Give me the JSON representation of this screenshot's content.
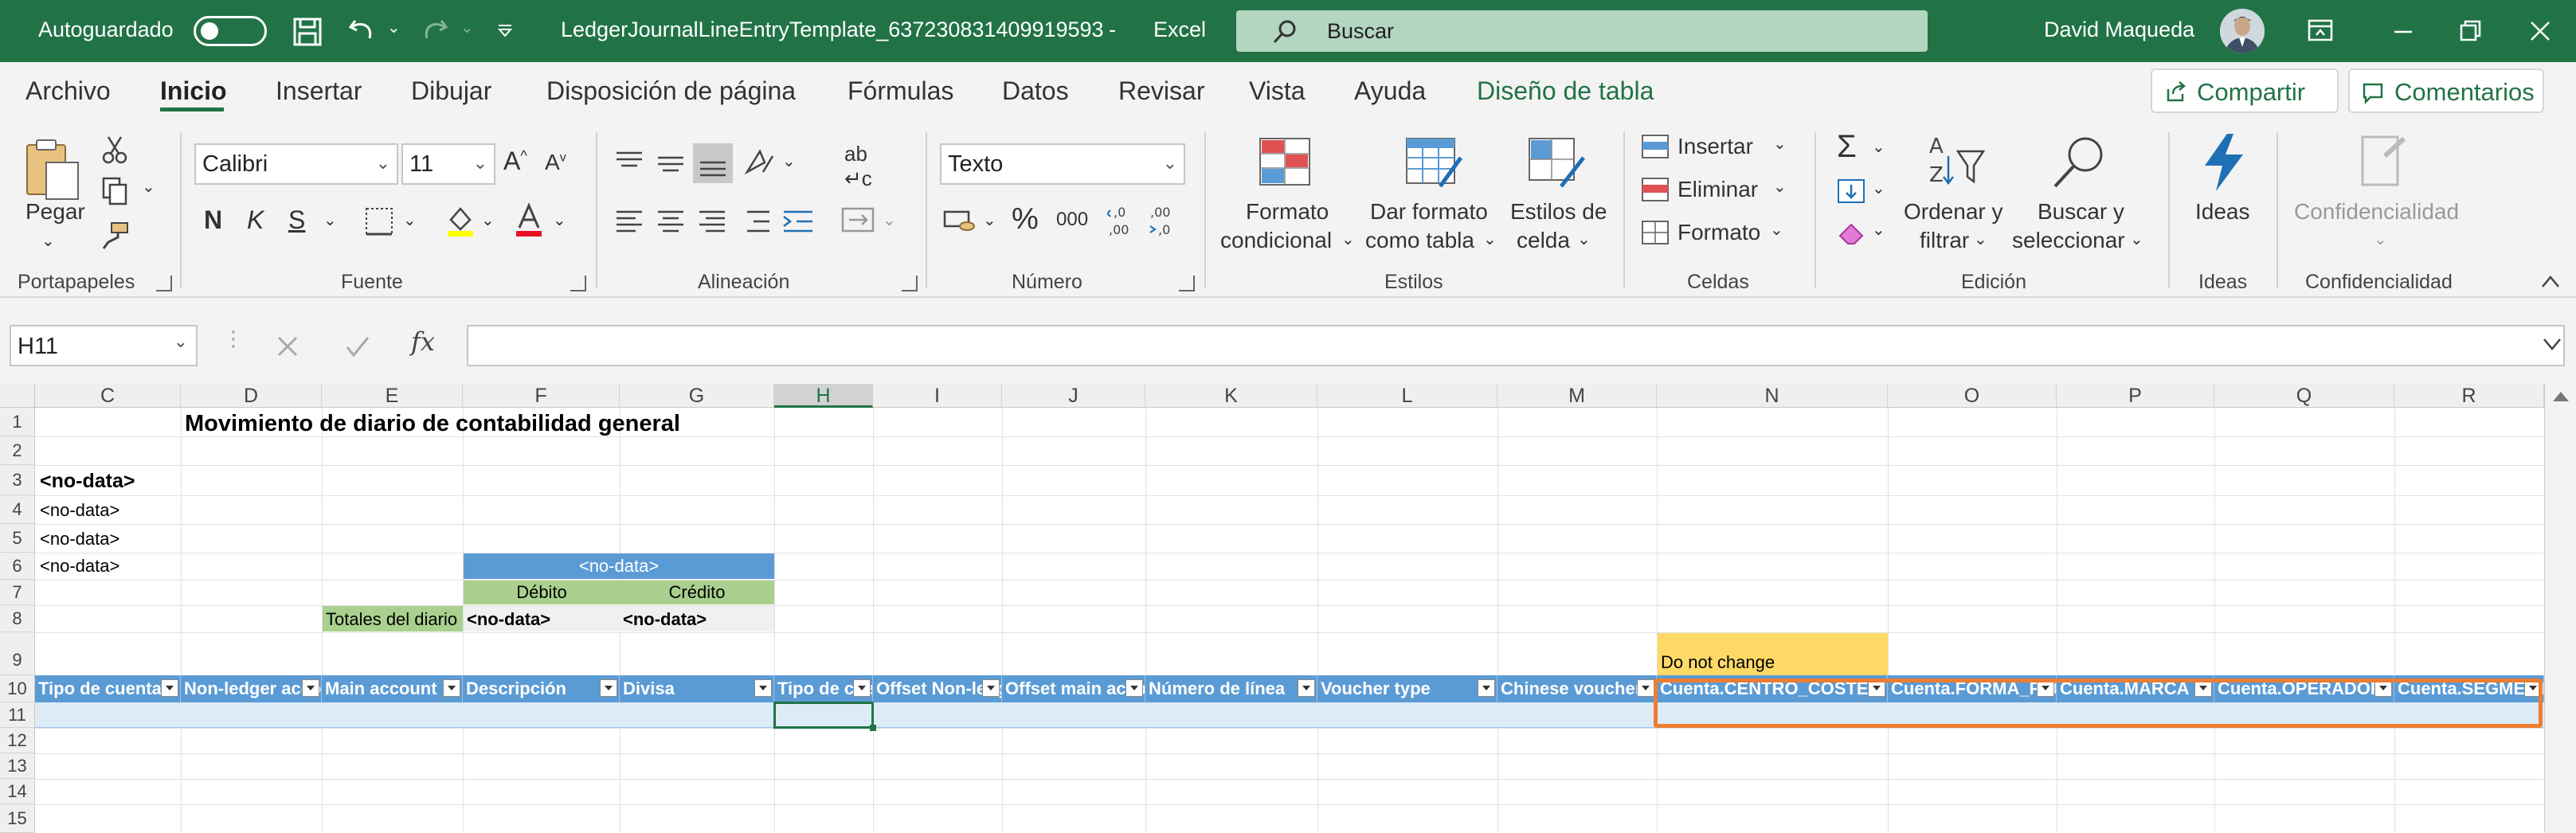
{
  "titlebar": {
    "autosave_label": "Autoguardado",
    "filename": "LedgerJournalLineEntryTemplate_637230831409919593",
    "separator": "-",
    "app": "Excel",
    "search_placeholder": "Buscar",
    "user": "David Maqueda"
  },
  "tabs": [
    {
      "label": "Archivo"
    },
    {
      "label": "Inicio"
    },
    {
      "label": "Insertar"
    },
    {
      "label": "Dibujar"
    },
    {
      "label": "Disposición de página"
    },
    {
      "label": "Fórmulas"
    },
    {
      "label": "Datos"
    },
    {
      "label": "Revisar"
    },
    {
      "label": "Vista"
    },
    {
      "label": "Ayuda"
    },
    {
      "label": "Diseño de tabla"
    }
  ],
  "actions": {
    "share": "Compartir",
    "comments": "Comentarios"
  },
  "ribbon": {
    "clipboard": {
      "paste": "Pegar",
      "label": "Portapapeles"
    },
    "font": {
      "name": "Calibri",
      "size": "11",
      "bold": "N",
      "italic": "K",
      "underline": "S",
      "label": "Fuente"
    },
    "alignment": {
      "label": "Alineación"
    },
    "number": {
      "format": "Texto",
      "percent": "%",
      "thousands": "000",
      "label": "Número"
    },
    "styles": {
      "conditional_1": "Formato",
      "conditional_2": "condicional",
      "table_1": "Dar formato",
      "table_2": "como tabla",
      "cell_1": "Estilos de",
      "cell_2": "celda",
      "label": "Estilos"
    },
    "cells": {
      "insert": "Insertar",
      "delete": "Eliminar",
      "format": "Formato",
      "label": "Celdas"
    },
    "editing": {
      "sort_1": "Ordenar y",
      "sort_2": "filtrar",
      "find_1": "Buscar y",
      "find_2": "seleccionar",
      "label": "Edición"
    },
    "ideas": {
      "button": "Ideas",
      "label": "Ideas"
    },
    "sensitivity": {
      "button": "Confidencialidad",
      "label": "Confidencialidad"
    }
  },
  "formula": {
    "namebox": "H11",
    "fx": "fx",
    "content": ""
  },
  "grid": {
    "columns": [
      "C",
      "D",
      "E",
      "F",
      "G",
      "H",
      "I",
      "J",
      "K",
      "L",
      "M",
      "N",
      "O",
      "P",
      "Q",
      "R"
    ],
    "rows": [
      "1",
      "2",
      "3",
      "4",
      "5",
      "6",
      "7",
      "8",
      "9",
      "10",
      "11",
      "12",
      "13",
      "14",
      "15"
    ],
    "title": "Movimiento de diario de contabilidad general",
    "c3": "<no-data>",
    "c4": "<no-data>",
    "c5": "<no-data>",
    "c6": "<no-data>",
    "f6": "<no-data>",
    "f7": "Débito",
    "g7": "Crédito",
    "e8": "Totales del diario",
    "f8": "<no-data>",
    "g8": "<no-data>",
    "n9": "Do not change",
    "table_headers": [
      "Tipo de cuenta",
      "Non-ledger account",
      "Main account",
      "Descripción",
      "Divisa",
      "Tipo de cuenta",
      "Offset Non-ledger",
      "Offset main account",
      "Número de línea",
      "Voucher type",
      "Chinese voucher",
      "Cuenta.CENTRO_COSTE",
      "Cuenta.FORMA_PAGO",
      "Cuenta.MARCA",
      "Cuenta.OPERADOR",
      "Cuenta.SEGMENTO"
    ]
  },
  "colors": {
    "excel_green": "#217346",
    "table_blue": "#5b9bd5",
    "light_green": "#a9d08e",
    "yellow": "#ffd966",
    "highlight": "#ed7d31"
  }
}
